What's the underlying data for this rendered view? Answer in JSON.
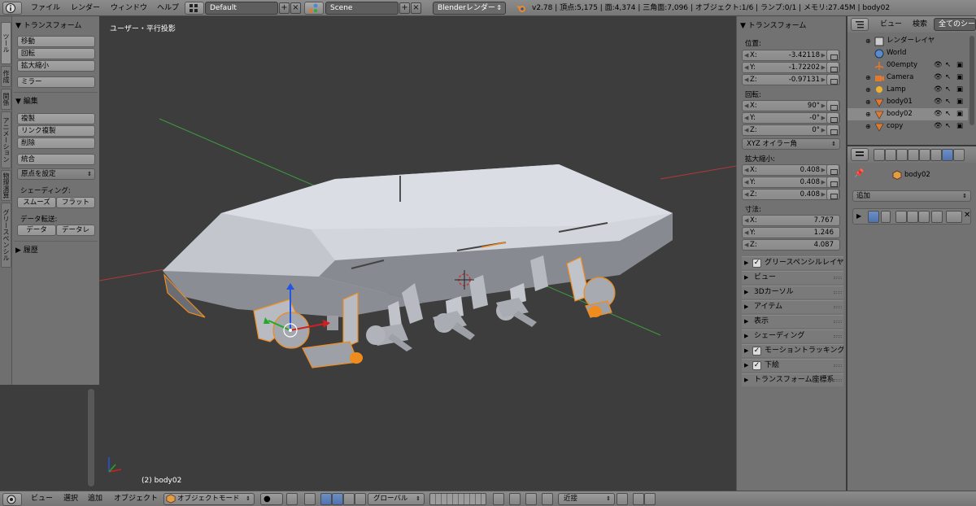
{
  "top": {
    "menu": [
      "ファイル",
      "レンダー",
      "ウィンドウ",
      "ヘルプ"
    ],
    "layout": "Default",
    "scene": "Scene",
    "engine": "Blenderレンダー",
    "stats": "v2.78 | 頂点:5,175 | 面:4,374 | 三角面:7,096 | オブジェクト:1/6 | ランプ:0/1 | メモリ:27.45M | body02"
  },
  "tabs": [
    "ツール",
    "作成",
    "関係",
    "アニメーション",
    "物理演算",
    "グリースペンシル"
  ],
  "toolshelf": {
    "transform_header": "▼ トランスフォーム",
    "transform_buttons": [
      "移動",
      "回転",
      "拡大縮小"
    ],
    "mirror": "ミラー",
    "edit_header": "▼ 編集",
    "edit_buttons": [
      "複製",
      "リンク複製",
      "削除"
    ],
    "join": "統合",
    "origin": "原点を設定",
    "shading_label": "シェーディング:",
    "smooth": "スムーズ",
    "flat": "フラット",
    "data_transfer_label": "データ転送:",
    "data": "データ",
    "data_layout": "データレ",
    "history_header": "▶ 履歴"
  },
  "viewport": {
    "title": "ユーザー・平行投影",
    "object_label": "(2) body02"
  },
  "n_panel": {
    "header": "▼ トランスフォーム",
    "location_label": "位置:",
    "location": [
      {
        "k": "X:",
        "v": "-3.42118"
      },
      {
        "k": "Y:",
        "v": "-1.72202"
      },
      {
        "k": "Z:",
        "v": "-0.97131"
      }
    ],
    "rotation_label": "回転:",
    "rotation": [
      {
        "k": "X:",
        "v": "90°"
      },
      {
        "k": "Y:",
        "v": "-0°"
      },
      {
        "k": "Z:",
        "v": "0°"
      }
    ],
    "rotation_mode": "XYZ オイラー角",
    "scale_label": "拡大縮小:",
    "scale": [
      {
        "k": "X:",
        "v": "0.408"
      },
      {
        "k": "Y:",
        "v": "0.408"
      },
      {
        "k": "Z:",
        "v": "0.408"
      }
    ],
    "dimensions_label": "寸法:",
    "dimensions": [
      {
        "k": "X:",
        "v": "7.767"
      },
      {
        "k": "Y:",
        "v": "1.246"
      },
      {
        "k": "Z:",
        "v": "4.087"
      }
    ],
    "subpanels": [
      {
        "label": "グリースペンシルレイヤ",
        "checkbox": true
      },
      {
        "label": "ビュー",
        "checkbox": false
      },
      {
        "label": "3Dカーソル",
        "checkbox": false
      },
      {
        "label": "アイテム",
        "checkbox": false
      },
      {
        "label": "表示",
        "checkbox": false
      },
      {
        "label": "シェーディング",
        "checkbox": false
      },
      {
        "label": "モーショントラッキング",
        "checkbox": true
      },
      {
        "label": "下絵",
        "checkbox": true
      },
      {
        "label": "トランスフォーム座標系",
        "checkbox": false
      }
    ]
  },
  "outliner": {
    "view": "ビュー",
    "search": "検索",
    "filter": "全てのシーン",
    "items": [
      {
        "name": "レンダーレイヤ",
        "icon": "render-layers-icon"
      },
      {
        "name": "World",
        "icon": "world-icon"
      },
      {
        "name": "00empty",
        "icon": "empty-icon"
      },
      {
        "name": "Camera",
        "icon": "camera-icon"
      },
      {
        "name": "Lamp",
        "icon": "lamp-icon"
      },
      {
        "name": "body01",
        "icon": "mesh-icon"
      },
      {
        "name": "body02",
        "icon": "mesh-icon"
      },
      {
        "name": "copy",
        "icon": "mesh-icon"
      }
    ]
  },
  "properties_editor": {
    "breadcrumb": "body02",
    "add_modifier": "追加"
  },
  "bottom": {
    "menu": [
      "ビュー",
      "選択",
      "追加",
      "オブジェクト"
    ],
    "mode": "オブジェクトモード",
    "orientation": "グローバル",
    "snap": "近接"
  },
  "colors": {
    "viewport_bg": "#3d3d3d",
    "panel_bg": "#727272",
    "selection_orange": "#f08c1e",
    "x_axis": "#b03a3a",
    "y_axis": "#3e9a3e"
  }
}
